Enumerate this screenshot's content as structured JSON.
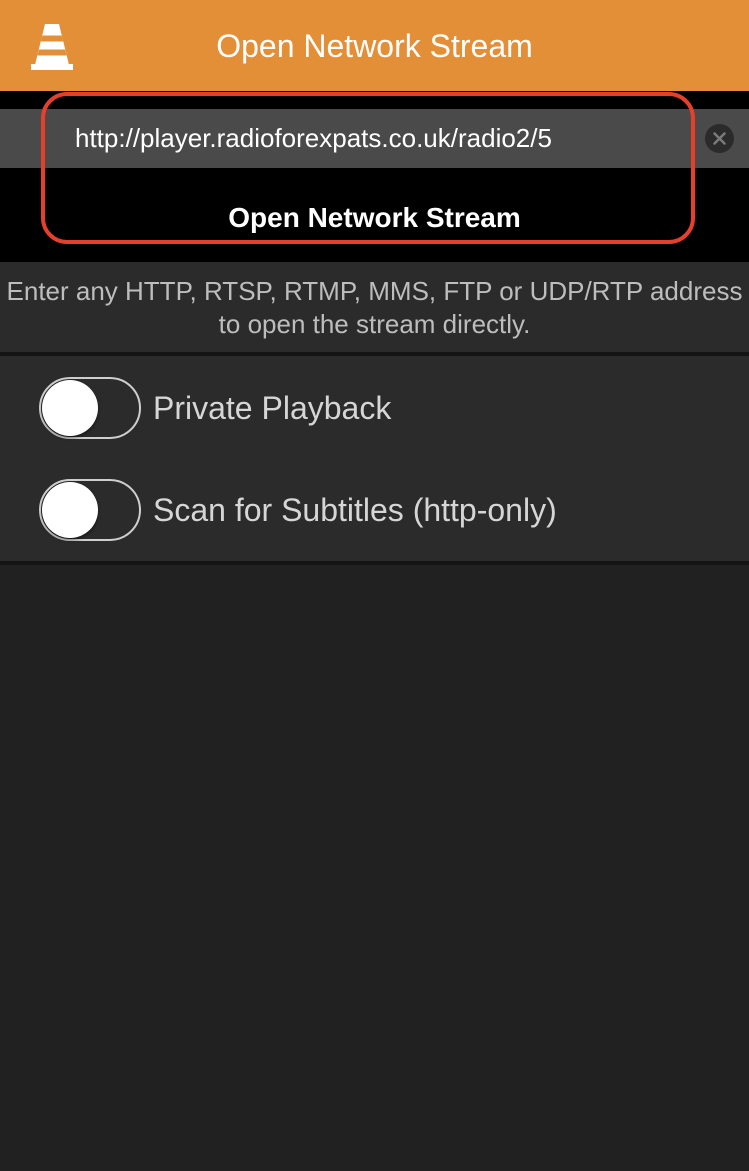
{
  "nav": {
    "title": "Open Network Stream",
    "logo_icon": "vlc-cone-icon",
    "background": "#E38F37"
  },
  "stream": {
    "url_value": "http://player.radioforexpats.co.uk/radio2/5",
    "clear_icon": "clear-x-icon",
    "open_label": "Open Network Stream",
    "highlight_color": "#E5402C"
  },
  "hint": {
    "text": "Enter any HTTP, RTSP, RTMP, MMS, FTP or UDP/RTP address to open the stream directly."
  },
  "options": [
    {
      "label": "Private Playback",
      "on": false
    },
    {
      "label": "Scan for Subtitles (http-only)",
      "on": false
    }
  ]
}
